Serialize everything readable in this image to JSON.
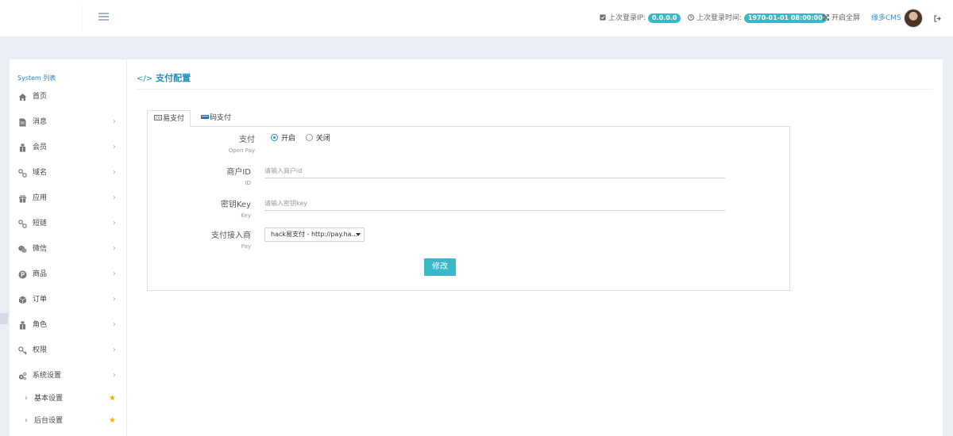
{
  "header": {
    "last_ip_label": "上次登录IP:",
    "last_ip_value": "0.0.0.0",
    "last_time_label": "上次登录时间:",
    "last_time_value": "1970-01-01 08:00:00",
    "fullscreen_label": "开启全屏",
    "user_name": "缘多CMS",
    "pill_color": "#3ab8c9"
  },
  "sidebar": {
    "title": "System 列表",
    "items": [
      {
        "label": "首页",
        "icon": "home-icon"
      },
      {
        "label": "消息",
        "icon": "file-icon"
      },
      {
        "label": "会员",
        "icon": "user-icon"
      },
      {
        "label": "域名",
        "icon": "link-icon"
      },
      {
        "label": "应用",
        "icon": "gift-icon"
      },
      {
        "label": "短链",
        "icon": "link-icon"
      },
      {
        "label": "微信",
        "icon": "wechat-icon"
      },
      {
        "label": "商品",
        "icon": "product-icon"
      },
      {
        "label": "订单",
        "icon": "order-icon"
      },
      {
        "label": "角色",
        "icon": "role-icon"
      },
      {
        "label": "权限",
        "icon": "key-icon"
      },
      {
        "label": "系统设置",
        "icon": "gears-icon"
      }
    ],
    "sub_items": [
      {
        "label": "基本设置"
      },
      {
        "label": "后台设置"
      }
    ]
  },
  "main": {
    "title": "支付配置",
    "tabs": [
      {
        "label": "易支付"
      },
      {
        "label": "码支付"
      }
    ],
    "form": {
      "pay_label": "支付",
      "pay_sub": "Open Pay",
      "pay_on": "开启",
      "pay_off": "关闭",
      "merchant_label": "商户ID",
      "merchant_sub": "ID",
      "merchant_placeholder": "请输入商户id",
      "key_label": "密钥Key",
      "key_sub": "Key",
      "key_placeholder": "请输入密钥key",
      "provider_label": "支付接入商",
      "provider_sub": "Pay",
      "provider_value": "hack易支付 - http://pay.ha...",
      "submit_label": "修改"
    }
  }
}
